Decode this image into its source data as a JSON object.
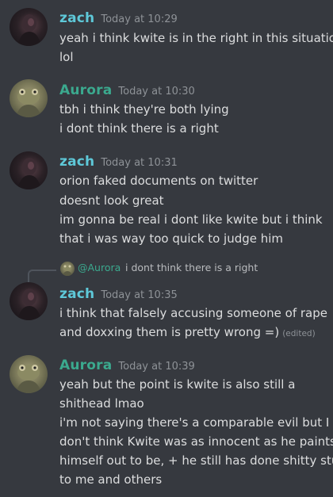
{
  "colors": {
    "background": "#36393f",
    "zach_name": "#5ec8d8",
    "aurora_name": "#3ba98e",
    "timestamp": "#8e9297",
    "text": "#dcddde"
  },
  "messages": [
    {
      "author": "zach",
      "timestamp": "Today at 10:29",
      "avatar_icon": "dark-portrait-avatar",
      "lines": [
        "yeah i think kwite is in the right in this situation",
        "lol"
      ]
    },
    {
      "author": "Aurora",
      "timestamp": "Today at 10:30",
      "avatar_icon": "frog-portrait-avatar",
      "lines": [
        "tbh i think they're both lying",
        "i dont think there is a right"
      ]
    },
    {
      "author": "zach",
      "timestamp": "Today at 10:31",
      "avatar_icon": "dark-portrait-avatar",
      "lines": [
        "orion faked documents on twitter",
        "doesnt look great",
        "im gonna be real i dont like kwite but i think",
        "that i was way too quick to judge him"
      ]
    },
    {
      "author": "zach",
      "timestamp": "Today at 10:35",
      "avatar_icon": "dark-portrait-avatar",
      "reply": {
        "author": "@Aurora",
        "text": "i dont think there is a right"
      },
      "lines": [
        "i think that falsely accusing someone of rape",
        "and doxxing them is pretty wrong =)"
      ],
      "edited_label": "(edited)"
    },
    {
      "author": "Aurora",
      "timestamp": "Today at 10:39",
      "avatar_icon": "frog-portrait-avatar",
      "lines": [
        "yeah but the point is kwite is also still a",
        "shithead lmao",
        "i'm not saying there's a comparable evil but I",
        "don't think Kwite was as innocent as he paints",
        "himself out to be, + he still has done shitty stuff",
        "to me and others"
      ]
    }
  ]
}
